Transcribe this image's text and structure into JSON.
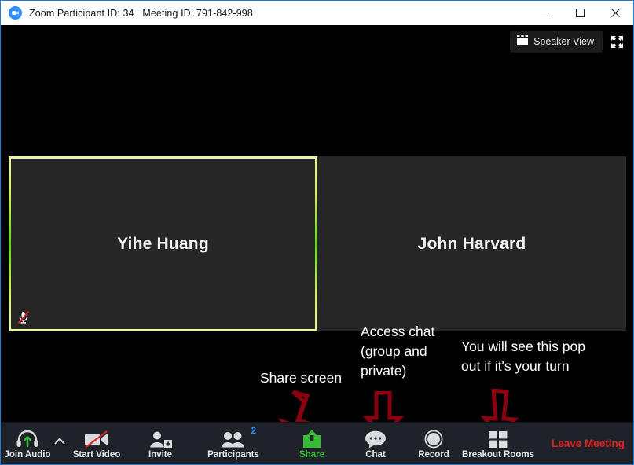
{
  "window": {
    "title": "Zoom Participant ID: 34   Meeting ID: 791-842-998",
    "logo_icon": "zoom-logo-icon",
    "minimize_icon": "minimize-icon",
    "maximize_icon": "maximize-icon",
    "close_icon": "close-icon"
  },
  "stage": {
    "view_button": {
      "label": "Speaker View",
      "icon": "layout-grid-icon"
    },
    "fullscreen_icon": "fullscreen-expand-icon",
    "tiles": [
      {
        "name": "Yihe Huang",
        "active_speaker": true,
        "muted": true,
        "mute_icon": "microphone-muted-icon"
      },
      {
        "name": "John Harvard",
        "active_speaker": false,
        "muted": false,
        "mute_icon": ""
      }
    ]
  },
  "annotations": [
    {
      "id": "share",
      "text": "Share screen"
    },
    {
      "id": "chat",
      "text": "Access chat\n(group and\nprivate)"
    },
    {
      "id": "breakout",
      "text": "You will see this pop\nout if it's your turn"
    }
  ],
  "toolbar": {
    "items": [
      {
        "label": "Join Audio",
        "icon": "headset-join-audio-icon",
        "badge": "",
        "accent": ""
      },
      {
        "label": "Start Video",
        "icon": "video-camera-off-icon",
        "badge": "",
        "accent": ""
      },
      {
        "label": "Invite",
        "icon": "invite-person-plus-icon",
        "badge": "",
        "accent": ""
      },
      {
        "label": "Participants",
        "icon": "participants-icon",
        "badge": "2",
        "accent": ""
      },
      {
        "label": "Share",
        "icon": "share-screen-icon",
        "badge": "",
        "accent": "green"
      },
      {
        "label": "Chat",
        "icon": "chat-bubble-icon",
        "badge": "",
        "accent": ""
      },
      {
        "label": "Record",
        "icon": "record-circle-icon",
        "badge": "",
        "accent": ""
      },
      {
        "label": "Breakout Rooms",
        "icon": "breakout-rooms-grid-icon",
        "badge": "",
        "accent": ""
      }
    ],
    "audio_caret_icon": "chevron-up-icon",
    "leave_label": "Leave Meeting"
  },
  "colors": {
    "accent_blue": "#2d8cff",
    "active_border_green": "#5fd51a",
    "share_green": "#35bb35",
    "leave_red": "#e02020",
    "arrow_crimson": "#8b0010",
    "toolbar_bg": "#1f2329",
    "tile_bg": "#262626"
  }
}
